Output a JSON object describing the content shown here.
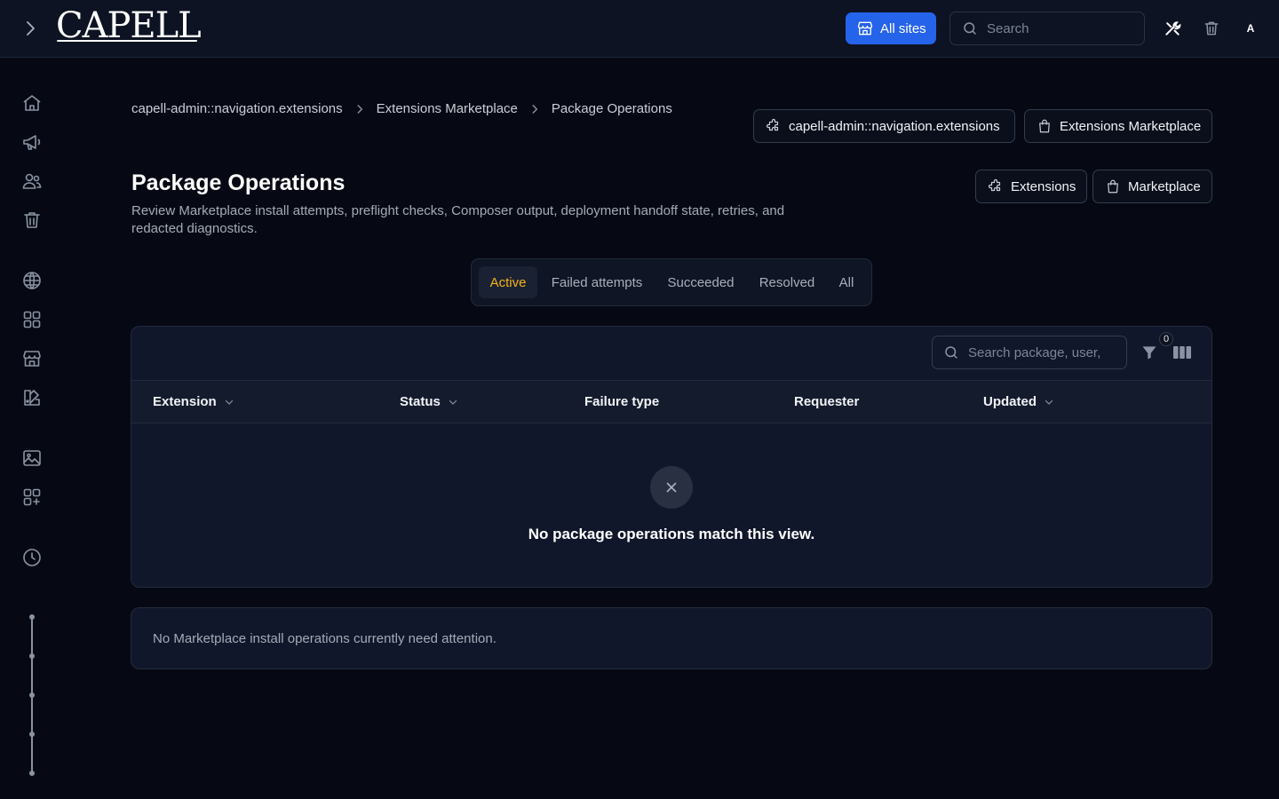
{
  "app": {
    "logo": "CAPELL"
  },
  "topbar": {
    "sites_label": "All sites",
    "search_placeholder": "Search",
    "avatar_initial": "A"
  },
  "sidebar": {
    "icons": [
      "home-icon",
      "megaphone-icon",
      "users-icon",
      "trash-icon",
      "globe-icon",
      "apps-grid-icon",
      "store-icon",
      "palette-icon",
      "image-icon",
      "add-apps-icon",
      "clock-icon"
    ]
  },
  "breadcrumb": [
    "capell-admin::navigation.extensions",
    "Extensions Marketplace",
    "Package Operations"
  ],
  "header_actions": {
    "extensions_nav": "capell-admin::navigation.extensions",
    "marketplace_nav": "Extensions Marketplace",
    "extensions": "Extensions",
    "marketplace": "Marketplace"
  },
  "page": {
    "title": "Package Operations",
    "description": "Review Marketplace install attempts, preflight checks, Composer output, deployment handoff state, retries, and redacted diagnostics."
  },
  "tabs": [
    {
      "label": "Active",
      "active": true
    },
    {
      "label": "Failed attempts",
      "active": false
    },
    {
      "label": "Succeeded",
      "active": false
    },
    {
      "label": "Resolved",
      "active": false
    },
    {
      "label": "All",
      "active": false
    }
  ],
  "table": {
    "search_placeholder": "Search package, user,",
    "filter_count": "0",
    "columns": [
      "Extension",
      "Status",
      "Failure type",
      "Requester",
      "Updated"
    ],
    "rows": [],
    "empty_message": "No package operations match this view."
  },
  "notice": "No Marketplace install operations currently need attention.",
  "colors": {
    "accent": "#2563eb",
    "active_tab": "#f5b316",
    "background": "#060913"
  }
}
